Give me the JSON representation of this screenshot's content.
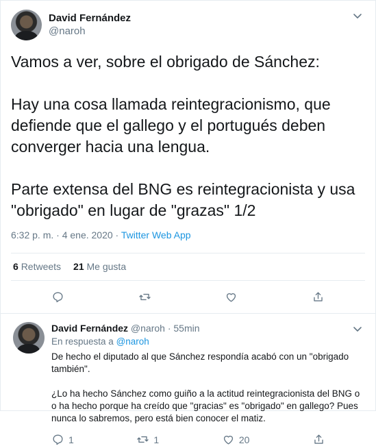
{
  "tweet": {
    "display_name": "David Fernández",
    "handle": "@naroh",
    "text": "Vamos a ver, sobre el obrigado de Sánchez:\n\nHay una cosa llamada reintegracionismo, que defiende que el gallego y el portugués deben converger hacia una lengua.\n\nParte extensa del BNG es reintegracionista y usa \"obrigado\" en lugar de \"grazas\" 1/2",
    "time": "6:32 p. m. · 4 ene. 2020 · ",
    "app": "Twitter Web App"
  },
  "stats": {
    "retweets_count": "6",
    "retweets_label": "Retweets",
    "likes_count": "21",
    "likes_label": "Me gusta"
  },
  "reply": {
    "display_name": "David Fernández",
    "handle_time": "@naroh · 55min",
    "in_reply_prefix": "En respuesta a ",
    "in_reply_handle": "@naroh",
    "text": "De hecho el diputado al que Sánchez respondía acabó con un \"obrigado también\".\n\n¿Lo ha hecho Sánchez como guiño a la actitud reintegracionista del BNG o o ha hecho porque ha creído que \"gracias\" es \"obrigado\" en gallego? Pues nunca lo sabremos, pero está bien conocer el matiz.",
    "reply_count": "1",
    "retweet_count": "1",
    "like_count": "20"
  },
  "icons": {
    "reply": "reply-icon",
    "retweet": "retweet-icon",
    "like": "heart-icon",
    "share": "share-icon",
    "more": "chevron-down-icon"
  },
  "colors": {
    "text": "#14171a",
    "secondary": "#657786",
    "link": "#1b95e0",
    "border": "#e6ecf0"
  }
}
